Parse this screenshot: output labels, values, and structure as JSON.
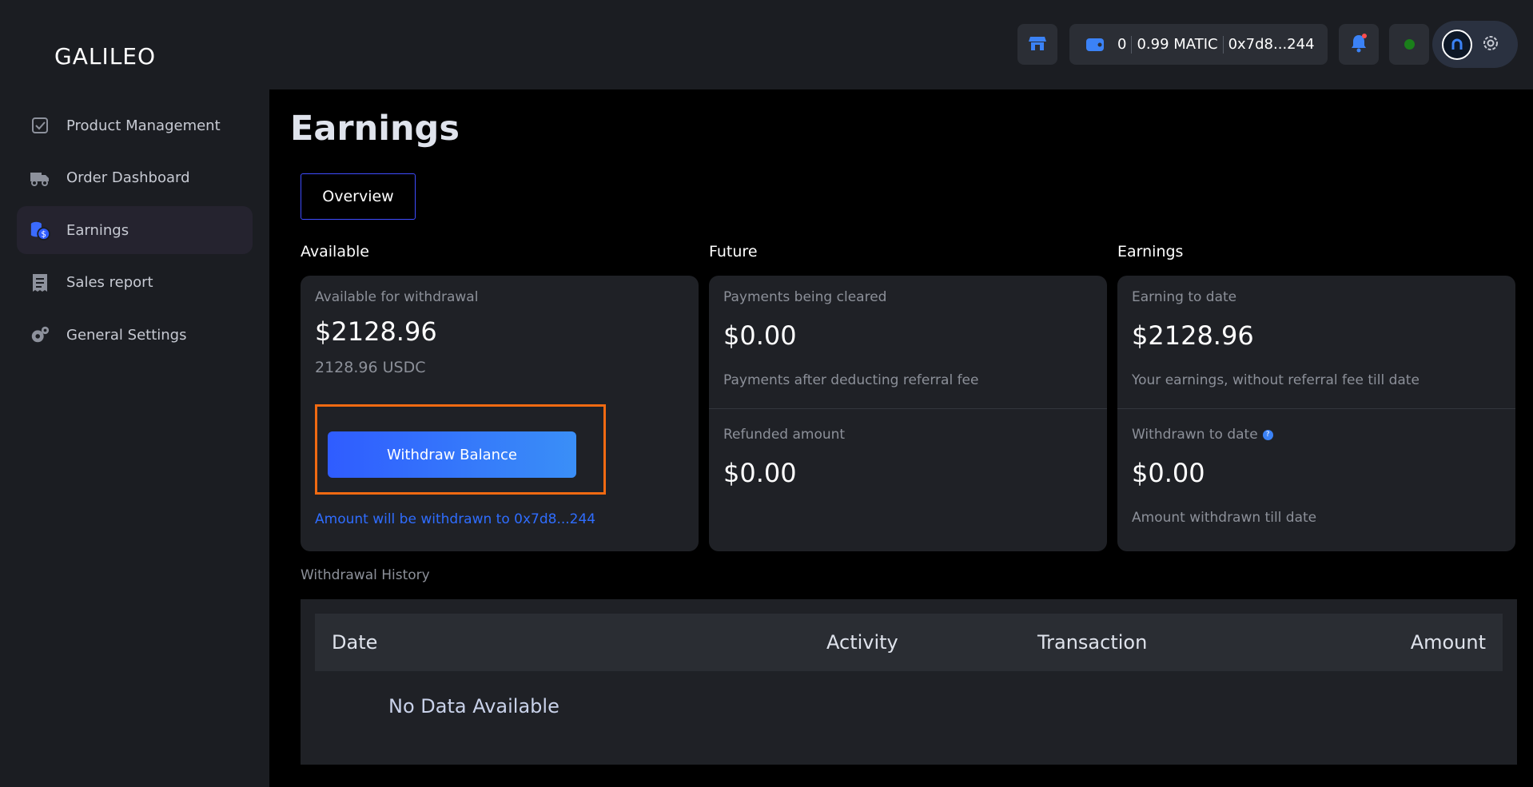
{
  "brand": {
    "logo_text": "GALILEO"
  },
  "sidebar": {
    "items": [
      {
        "label": "Product Management",
        "icon": "checkbox-icon",
        "active": false
      },
      {
        "label": "Order Dashboard",
        "icon": "truck-icon",
        "active": false
      },
      {
        "label": "Earnings",
        "icon": "coins-icon",
        "active": true
      },
      {
        "label": "Sales report",
        "icon": "receipt-icon",
        "active": false
      },
      {
        "label": "General Settings",
        "icon": "gears-icon",
        "active": false
      }
    ]
  },
  "topbar": {
    "wallet_count": "0",
    "wallet_balance": "0.99 MATIC",
    "wallet_address": "0x7d8...244"
  },
  "page": {
    "title": "Earnings",
    "tabs": [
      {
        "label": "Overview",
        "active": true
      }
    ]
  },
  "available": {
    "section_label": "Available",
    "caption": "Available for withdrawal",
    "amount": "$2128.96",
    "amount_usdc": "2128.96 USDC",
    "withdraw_button": "Withdraw Balance",
    "withdraw_note": "Amount will be withdrawn to 0x7d8...244"
  },
  "future": {
    "section_label": "Future",
    "cleared_caption": "Payments being cleared",
    "cleared_amount": "$0.00",
    "cleared_note": "Payments after deducting referral fee",
    "refunded_caption": "Refunded amount",
    "refunded_amount": "$0.00"
  },
  "earnings": {
    "section_label": "Earnings",
    "to_date_caption": "Earning to date",
    "to_date_amount": "$2128.96",
    "to_date_note": "Your earnings, without referral fee till date",
    "withdrawn_caption": "Withdrawn to date",
    "withdrawn_amount": "$0.00",
    "withdrawn_note": "Amount withdrawn till date"
  },
  "history": {
    "label": "Withdrawal History",
    "columns": [
      "Date",
      "Activity",
      "Transaction",
      "Amount"
    ],
    "empty_text": "No Data Available"
  },
  "colors": {
    "accent": "#3b6bff",
    "highlight_outline": "#f06a12",
    "status_online": "#1a7f1a"
  }
}
